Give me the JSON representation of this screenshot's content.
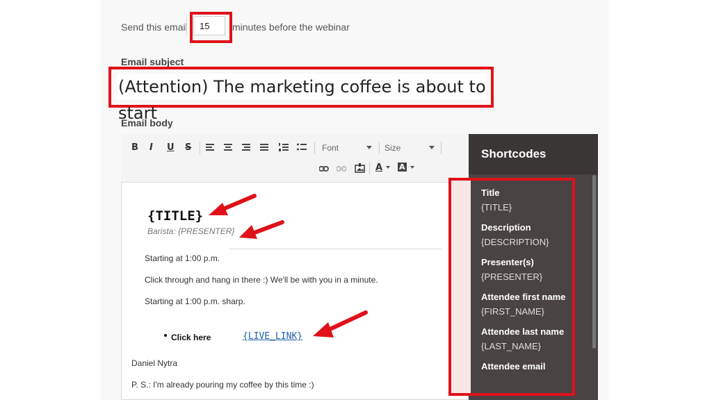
{
  "send": {
    "prefix": "Send this email",
    "minutes": "15",
    "suffix": "minutes before the webinar"
  },
  "subject": {
    "label": "Email subject",
    "value": "(Attention) The marketing coffee is about to start"
  },
  "body": {
    "label": "Email body",
    "toolbar": {
      "bold": "B",
      "italic": "I",
      "underline": "U",
      "strike": "S",
      "font_label": "Font",
      "size_label": "Size",
      "color_label": "A",
      "bg_color_label": "A"
    },
    "content": {
      "title_code": "{TITLE}",
      "barista": "Barista: {PRESENTER}",
      "line1": "Starting at 1:00 p.m.",
      "line2": "Click through and hang in there :) We'll be with you in a minute.",
      "line3": "Starting at 1:00 p.m. sharp.",
      "bullet_label": "Click here",
      "live_link": "{LIVE_LINK}",
      "signature": "Daniel Nytra",
      "ps": "P. S.: I'm already pouring my coffee by this time :)"
    }
  },
  "shortcodes": {
    "heading": "Shortcodes",
    "items": [
      {
        "title": "Title",
        "code": "{TITLE}"
      },
      {
        "title": "Description",
        "code": "{DESCRIPTION}"
      },
      {
        "title": "Presenter(s)",
        "code": "{PRESENTER}"
      },
      {
        "title": "Attendee first name",
        "code": "{FIRST_NAME}"
      },
      {
        "title": "Attendee last name",
        "code": "{LAST_NAME}"
      },
      {
        "title": "Attendee email",
        "code": ""
      }
    ]
  },
  "colors": {
    "highlight": "#e0111a",
    "panel_dark": "#4a4343",
    "link": "#1a5fa8"
  },
  "icons": [
    "align-left-icon",
    "align-center-icon",
    "align-right-icon",
    "align-justify-icon",
    "numbered-list-icon",
    "bullet-list-icon",
    "link-icon",
    "unlink-icon",
    "image-icon",
    "arrow-icon"
  ]
}
